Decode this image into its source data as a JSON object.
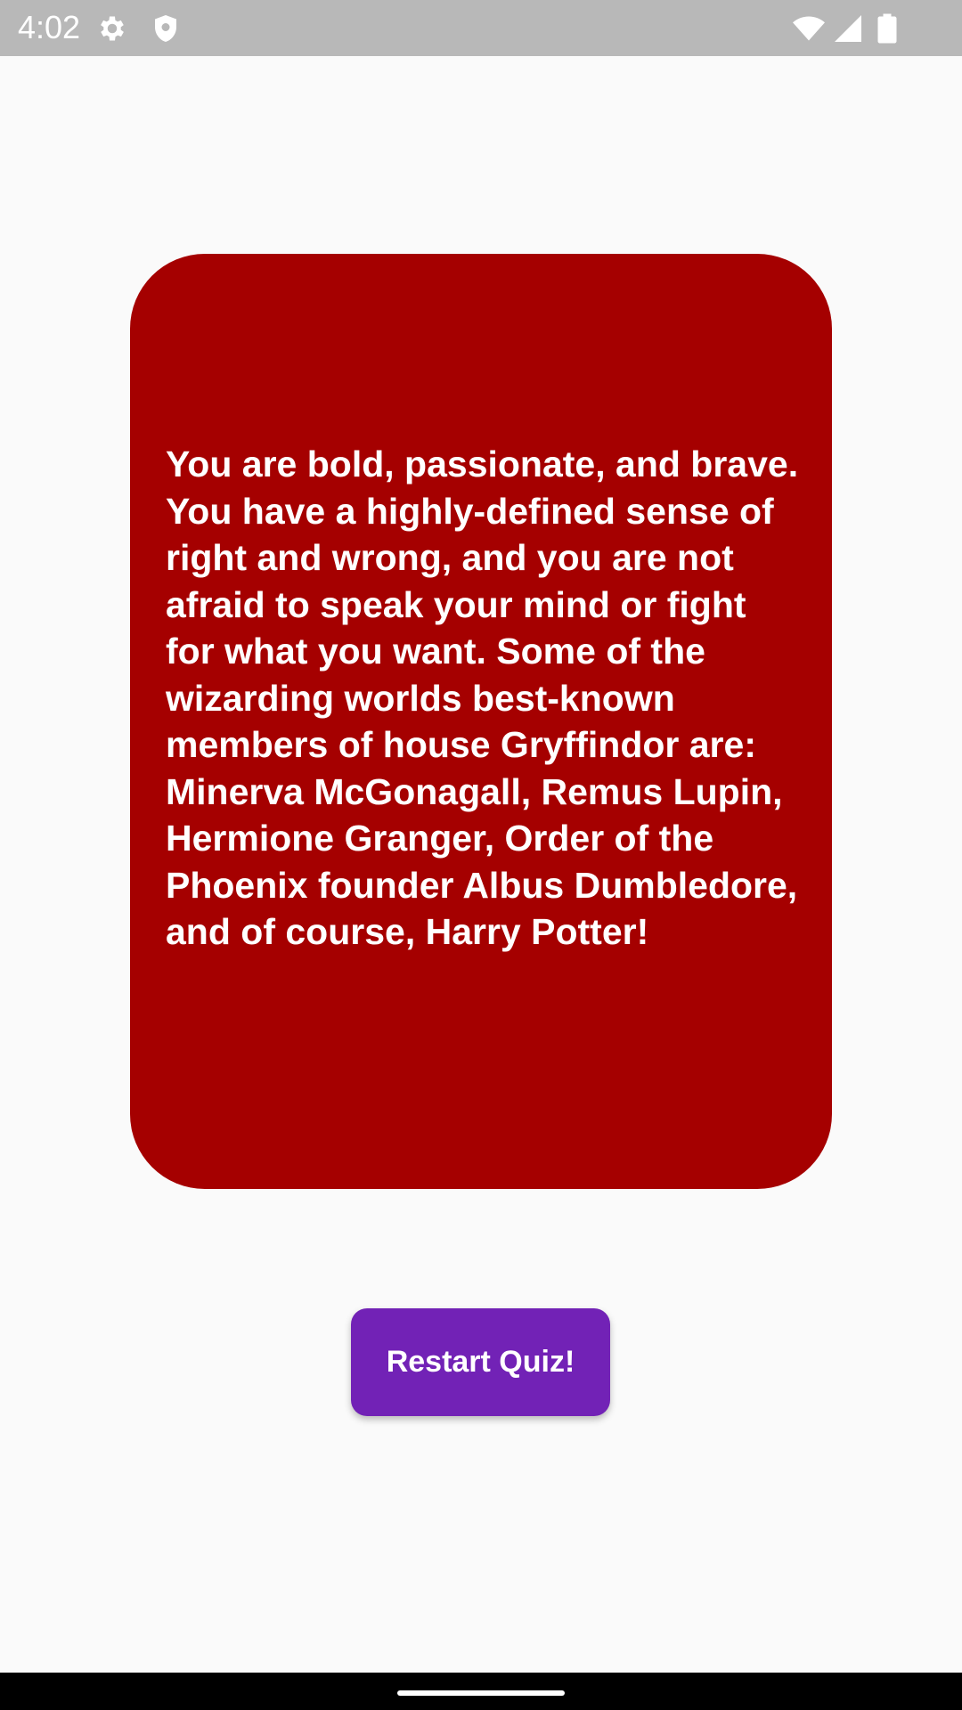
{
  "status_bar": {
    "time": "4:02",
    "icons": [
      "settings-icon",
      "shield-icon",
      "wifi-icon",
      "cell-signal-icon",
      "battery-icon"
    ]
  },
  "result": {
    "description": "You are bold, passionate, and brave. You have a highly-defined sense of right and wrong, and you are not afraid to speak your mind or fight for what you want. Some of the wizarding worlds best-known members of house Gryffindor are: Minerva McGonagall, Remus Lupin, Hermione Granger, Order of the Phoenix founder Albus Dumbledore, and of course, Harry Potter!",
    "card_color": "#a50000"
  },
  "actions": {
    "restart_label": "Restart Quiz!",
    "button_color": "#7222b6"
  }
}
